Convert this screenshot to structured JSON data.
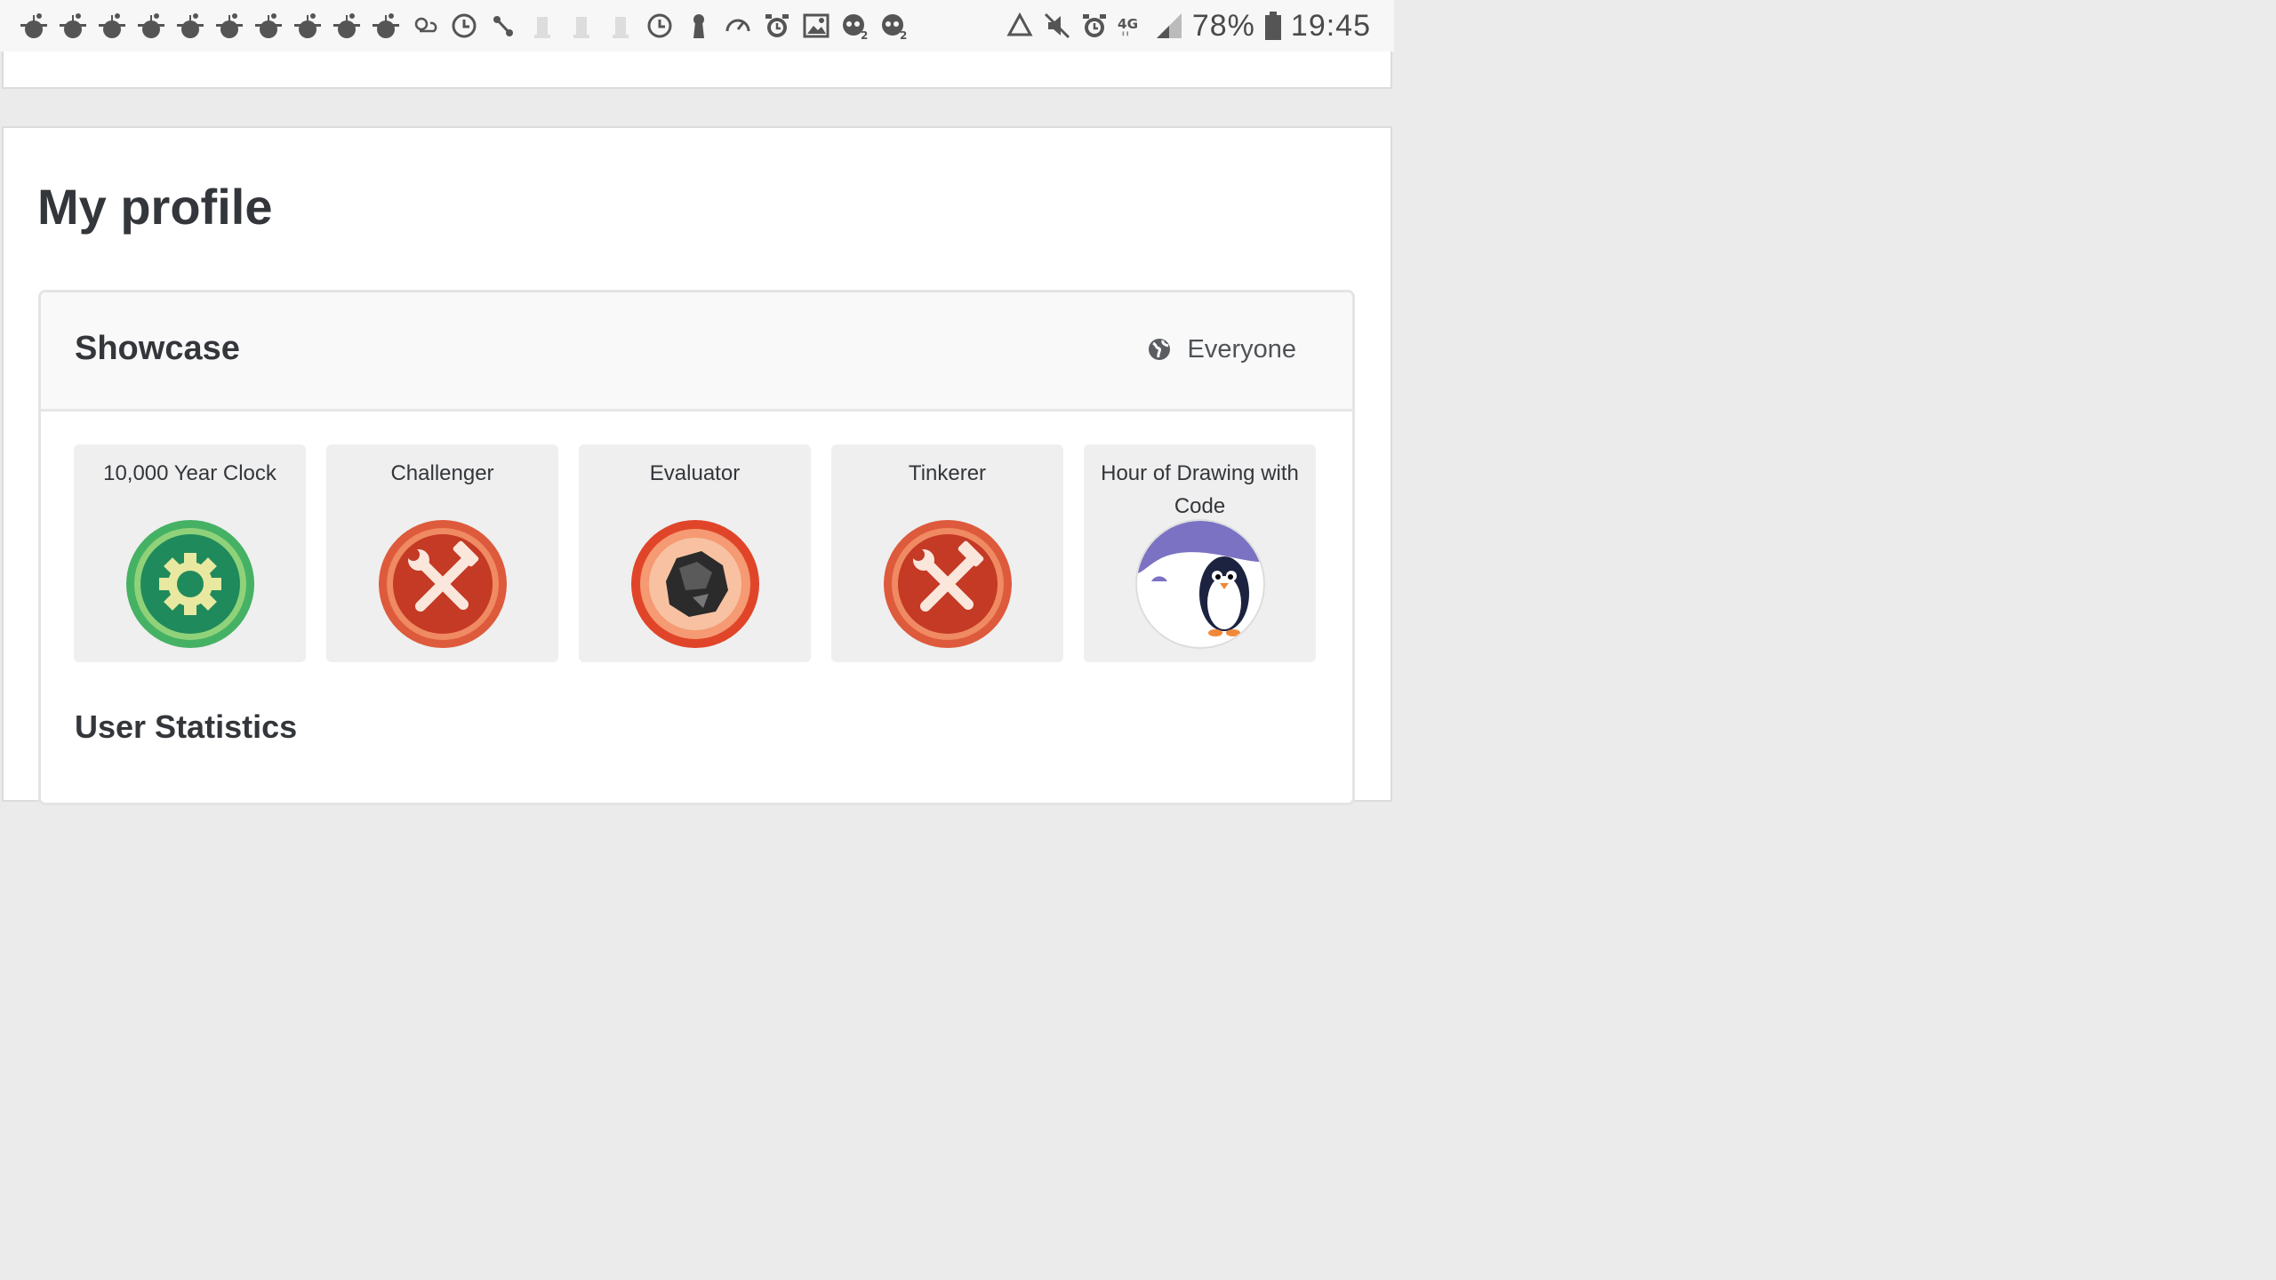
{
  "status_bar": {
    "notification_icons": [
      "reddit-icon",
      "reddit-icon",
      "reddit-icon",
      "reddit-icon",
      "reddit-icon",
      "reddit-icon",
      "reddit-icon",
      "reddit-icon",
      "reddit-icon",
      "reddit-icon",
      "weather-icon",
      "clock-icon",
      "route-icon",
      "chess-icon",
      "chess-icon",
      "chess-icon",
      "clock-icon",
      "keyhole-icon",
      "speedometer-icon",
      "alarm-icon",
      "image-icon",
      "game-icon",
      "game-icon"
    ],
    "system_icons": [
      "recycle-icon",
      "mute-icon",
      "alarm-icon",
      "network-4g-lte-icon",
      "signal-icon"
    ],
    "battery": "78%",
    "time": "19:45"
  },
  "page": {
    "title": "My profile"
  },
  "showcase": {
    "title": "Showcase",
    "visibility": "Everyone",
    "badges": [
      {
        "name": "10,000 Year Clock",
        "icon": "gear-badge-icon"
      },
      {
        "name": "Challenger",
        "icon": "tools-badge-icon"
      },
      {
        "name": "Evaluator",
        "icon": "meteorite-badge-icon"
      },
      {
        "name": "Tinkerer",
        "icon": "tools-badge-icon"
      },
      {
        "name": "Hour of Drawing with Code",
        "icon": "penguin-badge-icon"
      }
    ]
  },
  "stats": {
    "title": "User Statistics"
  },
  "colors": {
    "badge_green": "#3aa86b",
    "badge_red": "#d84a2e",
    "badge_purple": "#7b72c4",
    "background": "#ebebeb",
    "text": "#33363a"
  }
}
